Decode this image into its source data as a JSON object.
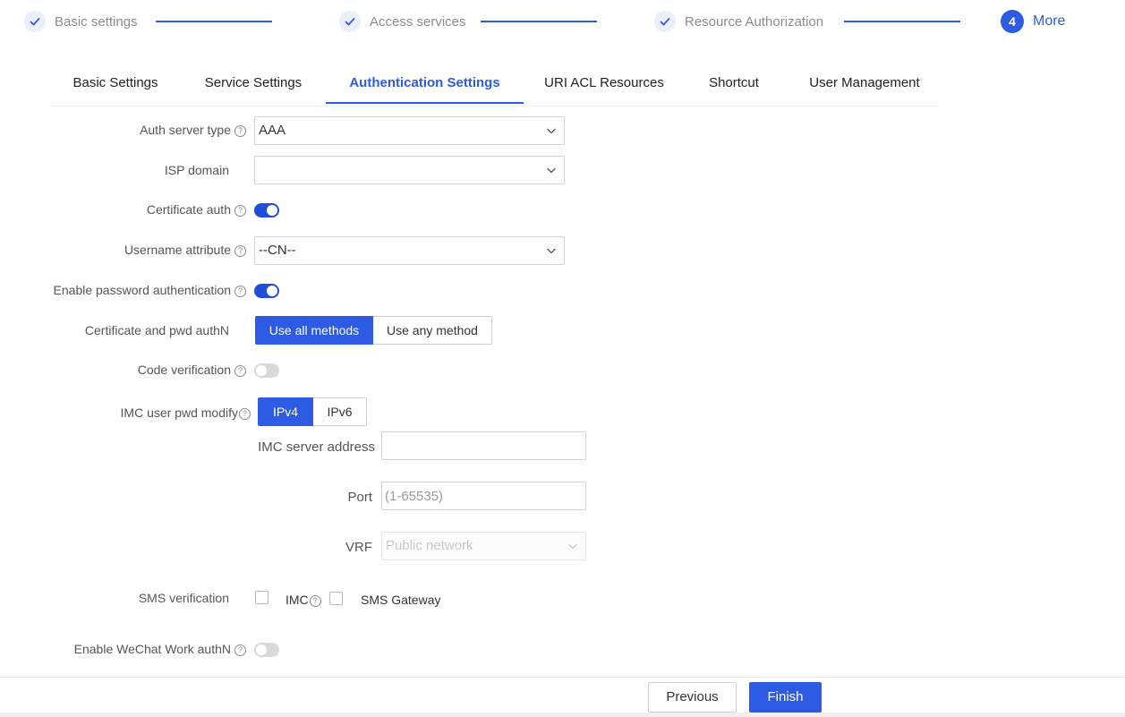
{
  "colors": {
    "accent": "#2d5be3",
    "toggle_on": "#1f4fd8",
    "toggle_off": "#d9d9d9",
    "muted": "#8c8c8c"
  },
  "stepper": {
    "steps": [
      {
        "label": "Basic settings",
        "state": "done",
        "icon": "check-icon"
      },
      {
        "label": "Access services",
        "state": "done",
        "icon": "check-icon"
      },
      {
        "label": "Resource Authorization",
        "state": "done",
        "icon": "check-icon"
      },
      {
        "number": "4",
        "label": "More",
        "state": "current"
      }
    ]
  },
  "tabs": [
    {
      "label": "Basic Settings"
    },
    {
      "label": "Service Settings"
    },
    {
      "label": "Authentication Settings",
      "active": true
    },
    {
      "label": "URI ACL Resources"
    },
    {
      "label": "Shortcut"
    },
    {
      "label": "User Management"
    }
  ],
  "help_glyph": "?",
  "form": {
    "auth_server_type": {
      "label": "Auth server type",
      "value": "AAA"
    },
    "isp_domain": {
      "label": "ISP domain",
      "value": ""
    },
    "certificate_auth": {
      "label": "Certificate auth",
      "on": true
    },
    "username_attribute": {
      "label": "Username attribute",
      "value": "--CN--"
    },
    "enable_password_auth": {
      "label": "Enable password authentication",
      "on": true
    },
    "cert_pwd_authn": {
      "label": "Certificate and pwd authN",
      "options": [
        "Use all methods",
        "Use any method"
      ],
      "selected": "Use all methods"
    },
    "code_verification": {
      "label": "Code verification",
      "on": false
    },
    "imc_user_pwd_modify": {
      "label": "IMC user pwd modify",
      "options": [
        "IPv4",
        "IPv6"
      ],
      "selected": "IPv4"
    },
    "imc_server_address": {
      "label": "IMC server address",
      "value": ""
    },
    "port": {
      "label": "Port",
      "value": "",
      "placeholder": "(1-65535)"
    },
    "vrf": {
      "label": "VRF",
      "value": "Public network"
    },
    "sms_verification": {
      "label": "SMS verification",
      "options": [
        {
          "label": "IMC",
          "checked": false
        },
        {
          "label": "SMS Gateway",
          "checked": false
        }
      ]
    },
    "wechat_work_authn": {
      "label": "Enable WeChat Work authN",
      "on": false
    }
  },
  "footer": {
    "previous_label": "Previous",
    "finish_label": "Finish"
  }
}
